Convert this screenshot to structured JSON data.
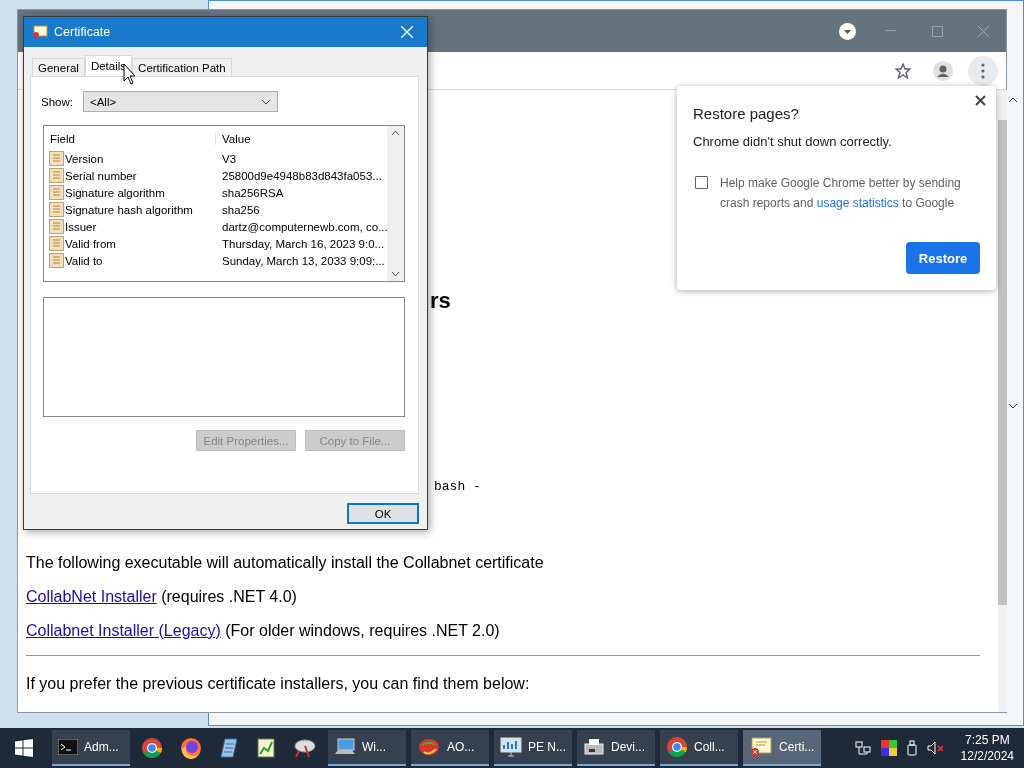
{
  "browser": {
    "page": {
      "heading_fragment": "rs",
      "code_fragment": "bash -",
      "paragraphs": [
        {
          "kind": "text",
          "text": "The following executable will automatically install the Collabnet certificate"
        },
        {
          "kind": "link",
          "link": "CollabNet Installer",
          "text": " (requires .NET 4.0)"
        },
        {
          "kind": "link",
          "link": "Collabnet Installer (Legacy)",
          "text": " (For older windows, requires .NET 2.0)"
        },
        {
          "kind": "rule"
        },
        {
          "kind": "text",
          "text": "If you prefer the previous certificate installers, you can find them below:"
        }
      ]
    }
  },
  "restore_popup": {
    "title": "Restore pages?",
    "message": "Chrome didn't shut down correctly.",
    "checkbox": {
      "checked": false,
      "before": "Help make Google Chrome better by sending crash reports and ",
      "link": "usage statistics",
      "after": " to Google"
    },
    "button": "Restore"
  },
  "certificate_dialog": {
    "title": "Certificate",
    "tabs": [
      {
        "label": "General",
        "selected": false
      },
      {
        "label": "Details",
        "selected": true
      },
      {
        "label": "Certification Path",
        "selected": false
      }
    ],
    "show_label": "Show:",
    "show_value": "<All>",
    "columns": [
      "Field",
      "Value"
    ],
    "rows": [
      {
        "field": "Version",
        "value": "V3"
      },
      {
        "field": "Serial number",
        "value": "25800d9e4948b83d843fa053..."
      },
      {
        "field": "Signature algorithm",
        "value": "sha256RSA"
      },
      {
        "field": "Signature hash algorithm",
        "value": "sha256"
      },
      {
        "field": "Issuer",
        "value": "dartz@computernewb.com, co..."
      },
      {
        "field": "Valid from",
        "value": "Thursday, March 16, 2023 9:0..."
      },
      {
        "field": "Valid to",
        "value": "Sunday, March 13, 2033 9:09:..."
      }
    ],
    "buttons": [
      {
        "label": "Edit Properties...",
        "disabled": true
      },
      {
        "label": "Copy to File...",
        "disabled": true
      }
    ],
    "ok_button": "OK"
  },
  "taskbar": {
    "items": [
      {
        "kind": "terminal",
        "label": "Adm...",
        "selected": false
      },
      {
        "kind": "chrome"
      },
      {
        "kind": "firefox"
      },
      {
        "kind": "notepad"
      },
      {
        "kind": "chart"
      },
      {
        "kind": "dish"
      },
      {
        "kind": "computer",
        "label": "Wi...",
        "selected": false
      },
      {
        "kind": "orb",
        "label": "AO...",
        "selected": false
      },
      {
        "kind": "monitor",
        "label": "PE N...",
        "selected": false
      },
      {
        "kind": "printer",
        "label": "Devi...",
        "selected": false
      },
      {
        "kind": "chrome",
        "label": "Coll...",
        "selected": false
      },
      {
        "kind": "certificate",
        "label": "Certi...",
        "selected": true
      }
    ],
    "clock": {
      "time": "7:25 PM",
      "date": "12/2/2024"
    }
  }
}
